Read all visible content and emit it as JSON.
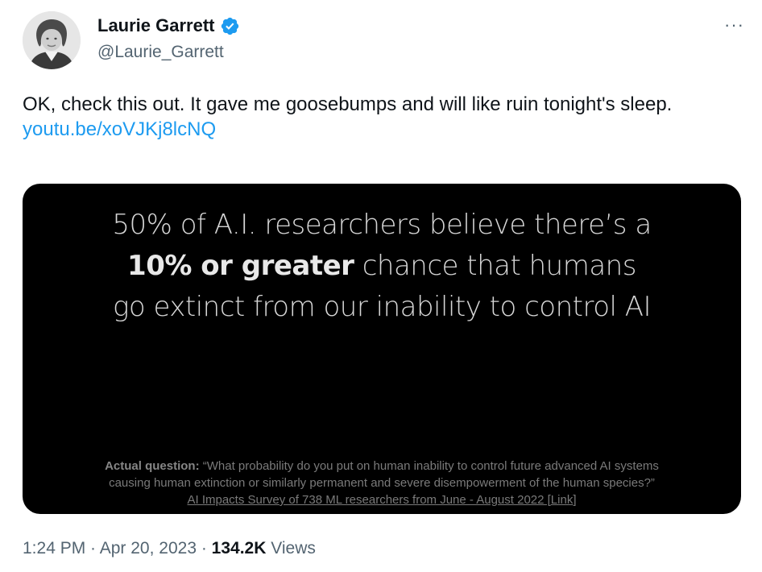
{
  "author": {
    "display_name": "Laurie Garrett",
    "handle": "@Laurie_Garrett",
    "verified_icon": "verified-badge-icon",
    "avatar_icon": "profile-photo"
  },
  "more_icon": "more-options-icon",
  "more_label": "···",
  "tweet": {
    "text": "OK, check this out. It gave me goosebumps and will like ruin tonight's sleep.",
    "link": "youtu.be/xoVJKj8lcNQ"
  },
  "media": {
    "line1": "50% of A.I. researchers believe there’s a",
    "line2_bold": "10% or greater",
    "line2_rest": " chance that humans",
    "line3": "go extinct from our inability to control AI",
    "question_label": "Actual question:",
    "question_text": " “What probability do you put on human inability to control future advanced AI systems",
    "question_text2": "causing human extinction or similarly permanent and severe disempowerment of the human species?”",
    "source": "AI Impacts Survey of 738 ML researchers from June - August 2022 [Link]"
  },
  "meta": {
    "time": "1:24 PM",
    "separator": " · ",
    "date": "Apr 20, 2023",
    "views_count": "134.2K",
    "views_label": " Views"
  },
  "colors": {
    "link": "#1d9bf0",
    "secondary": "#536471",
    "verified": "#1d9bf0",
    "media_bg": "#000000"
  }
}
